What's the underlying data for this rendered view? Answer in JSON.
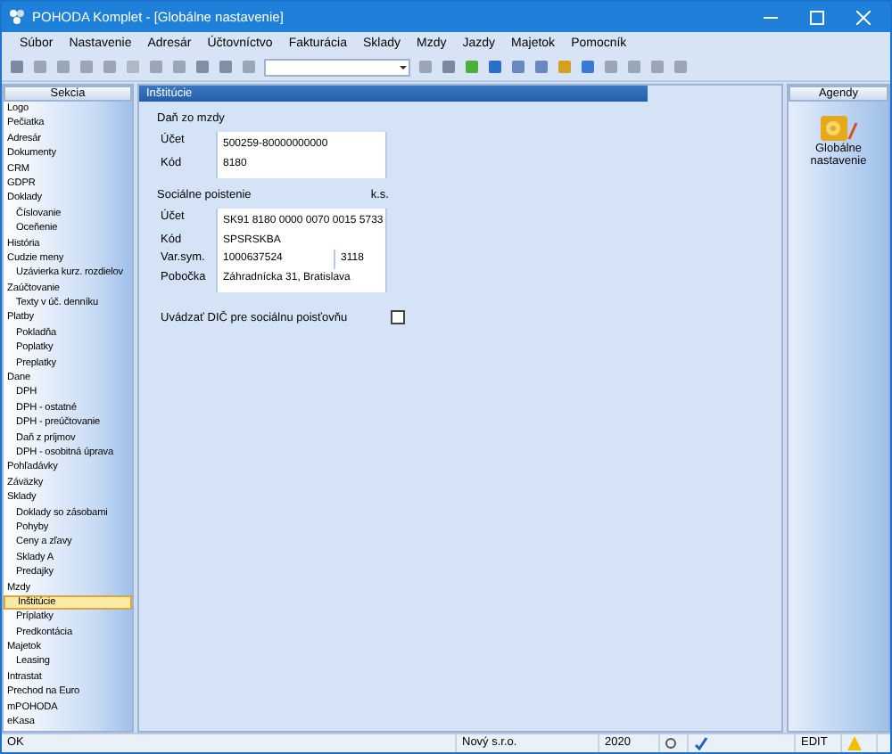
{
  "window": {
    "title": "POHODA Komplet - [Globálne nastavenie]"
  },
  "menu": [
    "Súbor",
    "Nastavenie",
    "Adresár",
    "Účtovníctvo",
    "Fakturácia",
    "Sklady",
    "Mzdy",
    "Jazdy",
    "Majetok",
    "Pomocník"
  ],
  "sidebar": {
    "header": "Sekcia",
    "items": [
      {
        "label": "Logo",
        "selected": false
      },
      {
        "label": "Pečiatka",
        "selected": false
      },
      {
        "label": "Adresár",
        "selected": false
      },
      {
        "label": "Dokumenty",
        "selected": false
      },
      {
        "label": "CRM",
        "selected": false
      },
      {
        "label": "GDPR",
        "selected": false
      },
      {
        "label": "Doklady",
        "selected": false,
        "children": [
          {
            "label": "Číslovanie",
            "selected": false
          },
          {
            "label": "Oceňenie",
            "selected": false
          }
        ]
      },
      {
        "label": "História",
        "selected": false
      },
      {
        "label": "Cudzie meny",
        "selected": false,
        "children": [
          {
            "label": "Uzávierka kurz. rozdielov",
            "selected": false
          }
        ]
      },
      {
        "label": "Zaúčtovanie",
        "selected": false,
        "children": [
          {
            "label": "Texty v úč. denníku",
            "selected": false
          }
        ]
      },
      {
        "label": "Platby",
        "selected": false,
        "children": [
          {
            "label": "Pokladňa",
            "selected": false
          },
          {
            "label": "Poplatky",
            "selected": false
          },
          {
            "label": "Preplatky",
            "selected": false
          }
        ]
      },
      {
        "label": "Dane",
        "selected": false,
        "children": [
          {
            "label": "DPH",
            "selected": false
          },
          {
            "label": "DPH - ostatné",
            "selected": false
          },
          {
            "label": "DPH - preúčtovanie",
            "selected": false
          },
          {
            "label": "Daň z príjmov",
            "selected": false
          },
          {
            "label": "DPH - osobitná úprava",
            "selected": false
          }
        ]
      },
      {
        "label": "Pohľadávky",
        "selected": false
      },
      {
        "label": "Záväzky",
        "selected": false
      },
      {
        "label": "Sklady",
        "selected": false,
        "children": [
          {
            "label": "Doklady so zásobami",
            "selected": false
          },
          {
            "label": "Pohyby",
            "selected": false
          },
          {
            "label": "Ceny a zľavy",
            "selected": false
          },
          {
            "label": "Sklady A",
            "selected": false
          },
          {
            "label": "Predajky",
            "selected": false
          }
        ]
      },
      {
        "label": "Mzdy",
        "selected": false,
        "children": [
          {
            "label": "Inštitúcie",
            "selected": true
          },
          {
            "label": "Príplatky",
            "selected": false
          },
          {
            "label": "Predkontácia",
            "selected": false
          }
        ]
      },
      {
        "label": "Majetok",
        "selected": false,
        "children": [
          {
            "label": "Leasing",
            "selected": false
          }
        ]
      },
      {
        "label": "Intrastat",
        "selected": false
      },
      {
        "label": "Prechod na Euro",
        "selected": false
      },
      {
        "label": "mPOHODA",
        "selected": false
      },
      {
        "label": "eKasa",
        "selected": false
      }
    ]
  },
  "panel": {
    "title": "Inštitúcie",
    "groups": [
      {
        "title": "Daň zo mzdy",
        "rows": [
          {
            "label": "Účet",
            "value": "500259-80000000000"
          },
          {
            "label": "Kód",
            "value": "8180"
          }
        ]
      },
      {
        "title": "Sociálne poistenie",
        "extra_label": "k.s.",
        "rows": [
          {
            "label": "Účet",
            "value": "SK91 8180 0000 0070 0015 5733"
          },
          {
            "label": "Kód",
            "value": "SPSRSKBA"
          },
          {
            "label": "Var.sym.",
            "value": "1000637524",
            "extra": "3118"
          },
          {
            "label": "Pobočka",
            "value": "Záhradnícka 31, Bratislava"
          }
        ]
      }
    ],
    "checkbox": {
      "label": "Uvádzať DIČ pre sociálnu poisťovňu",
      "checked": false
    }
  },
  "agendy": {
    "header": "Agendy",
    "items": [
      {
        "label": "Globálne nastavenie"
      }
    ]
  },
  "status_bar": {
    "message": "OK",
    "company": "Nový s.r.o.",
    "year": "2020",
    "mode": "EDIT"
  }
}
